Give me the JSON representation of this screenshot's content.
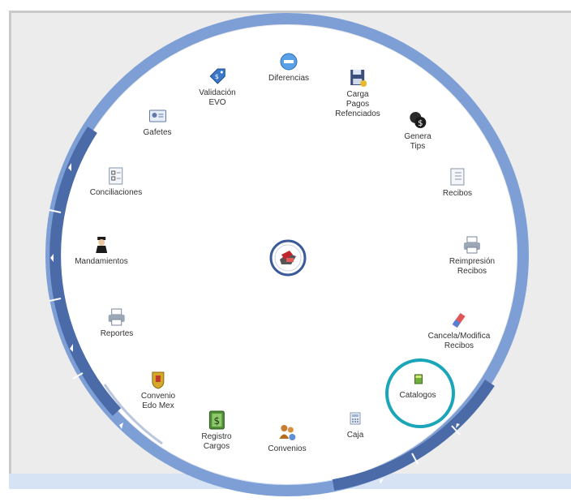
{
  "menu": {
    "items": [
      {
        "id": "diferencias",
        "label": "Diferencias",
        "icon": "minus-circle-icon"
      },
      {
        "id": "carga-pagos",
        "label": "Carga Pagos\nRefenciados",
        "icon": "floppy-disk-icon"
      },
      {
        "id": "genera-tips",
        "label": "Genera\nTips",
        "icon": "coins-icon"
      },
      {
        "id": "recibos",
        "label": "Recibos",
        "icon": "receipt-icon"
      },
      {
        "id": "reimpresion",
        "label": "Reimpresión\nRecibos",
        "icon": "printer-icon"
      },
      {
        "id": "cancela-modifica",
        "label": "Cancela/Modifica\nRecibos",
        "icon": "eraser-icon"
      },
      {
        "id": "catalogos",
        "label": "Catalogos",
        "icon": "book-icon"
      },
      {
        "id": "caja",
        "label": "Caja",
        "icon": "calculator-icon"
      },
      {
        "id": "convenios",
        "label": "Convenios",
        "icon": "people-gear-icon"
      },
      {
        "id": "registro-cargos",
        "label": "Registro\nCargos",
        "icon": "money-book-icon"
      },
      {
        "id": "convenio-edomex",
        "label": "Convenio\nEdo Mex",
        "icon": "coat-of-arms-icon"
      },
      {
        "id": "reportes",
        "label": "Reportes",
        "icon": "printer-icon"
      },
      {
        "id": "mandamientos",
        "label": "Mandamientos",
        "icon": "officer-icon"
      },
      {
        "id": "conciliaciones",
        "label": "Conciliaciones",
        "icon": "checklist-icon"
      },
      {
        "id": "gafetes",
        "label": "Gafetes",
        "icon": "id-card-icon"
      },
      {
        "id": "validacion-evo",
        "label": "Validación\nEVO",
        "icon": "price-tag-icon"
      }
    ]
  },
  "colors": {
    "ring_light": "#7d9fd6",
    "ring_dark": "#4b6aa8",
    "highlight": "#1ba5b8",
    "panel_bg": "#ececec",
    "bar_bg": "#d5e3f5"
  }
}
